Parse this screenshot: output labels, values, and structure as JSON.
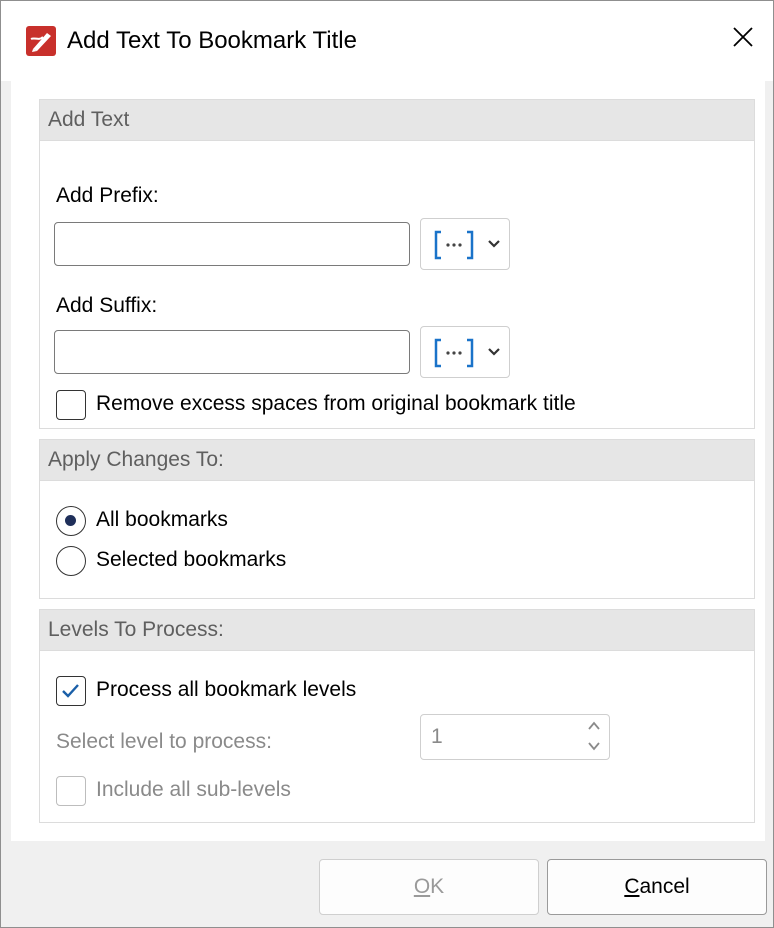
{
  "window": {
    "title": "Add Text To Bookmark Title"
  },
  "add_text": {
    "header": "Add Text",
    "prefix_label": "Add Prefix:",
    "prefix_value": "",
    "suffix_label": "Add Suffix:",
    "suffix_value": "",
    "remove_spaces_label": "Remove excess spaces from original bookmark title",
    "remove_spaces_checked": false
  },
  "apply_changes": {
    "header": "Apply Changes To:",
    "options": [
      {
        "label": "All bookmarks",
        "selected": true
      },
      {
        "label": "Selected bookmarks",
        "selected": false
      }
    ]
  },
  "levels": {
    "header": "Levels To Process:",
    "process_all_label": "Process all bookmark levels",
    "process_all_checked": true,
    "select_level_label": "Select level to process:",
    "select_level_value": "1",
    "include_sublevels_label": "Include all sub-levels",
    "include_sublevels_checked": false
  },
  "footer": {
    "ok_mnemonic": "O",
    "ok_rest": "K",
    "cancel_mnemonic": "C",
    "cancel_rest": "ancel"
  },
  "colors": {
    "accent": "#1a73c9",
    "app_icon": "#c8302b",
    "header_bg": "#e6e6e6"
  },
  "icons": {
    "app": "pdf-editor-app-icon",
    "close": "close-icon",
    "macro": "macro-brackets-icon",
    "dropdown": "chevron-down-icon",
    "checkmark": "checkmark-icon"
  }
}
